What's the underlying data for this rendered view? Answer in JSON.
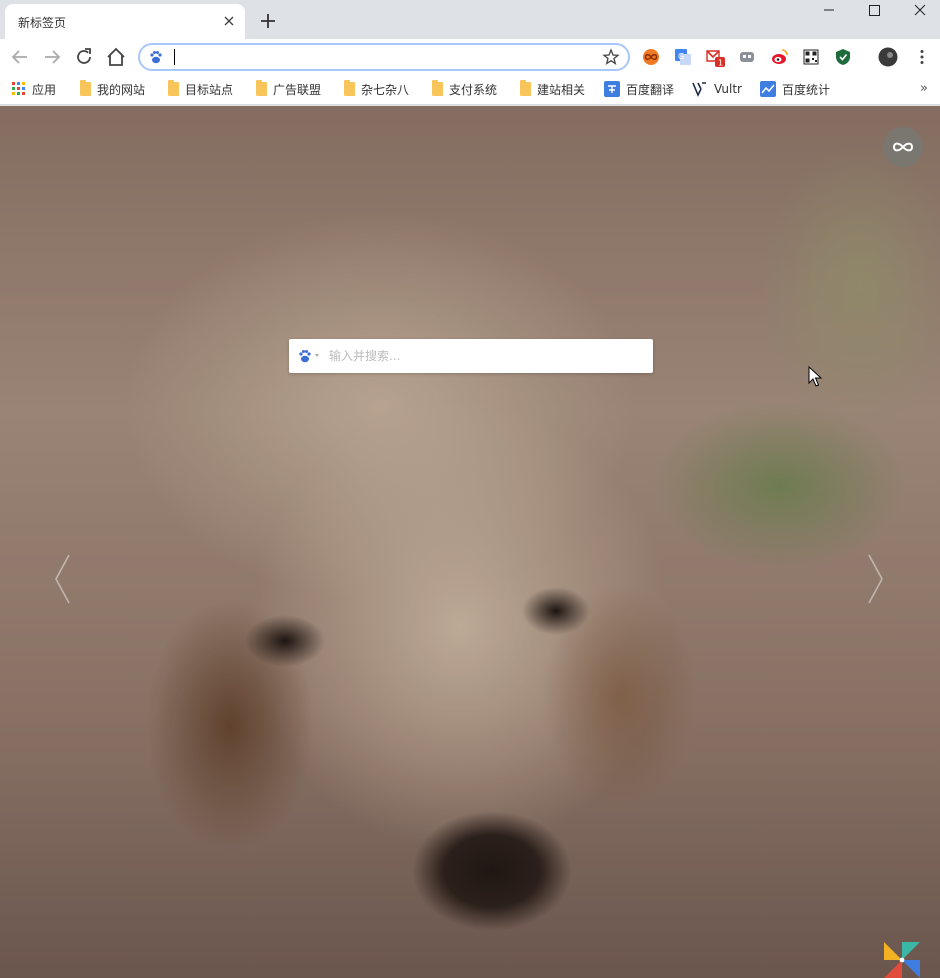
{
  "tab": {
    "title": "新标签页"
  },
  "omnibox": {
    "value": "",
    "placeholder": ""
  },
  "bookmarks": [
    {
      "label": "应用",
      "type": "apps"
    },
    {
      "label": "我的网站",
      "type": "folder"
    },
    {
      "label": "目标站点",
      "type": "folder"
    },
    {
      "label": "广告联盟",
      "type": "folder"
    },
    {
      "label": "杂七杂八",
      "type": "folder"
    },
    {
      "label": "支付系统",
      "type": "folder"
    },
    {
      "label": "建站相关",
      "type": "folder"
    },
    {
      "label": "百度翻译",
      "type": "link"
    },
    {
      "label": "Vultr",
      "type": "link"
    },
    {
      "label": "百度统计",
      "type": "link"
    }
  ],
  "bookmarks_more": "»",
  "extensions": {
    "gmail_badge": "1"
  },
  "search": {
    "placeholder": "输入并搜索...",
    "value": ""
  },
  "colors": {
    "accent": "#4285f4",
    "folder": "#f8c55b",
    "omnibox_border": "#a8c7fa"
  }
}
